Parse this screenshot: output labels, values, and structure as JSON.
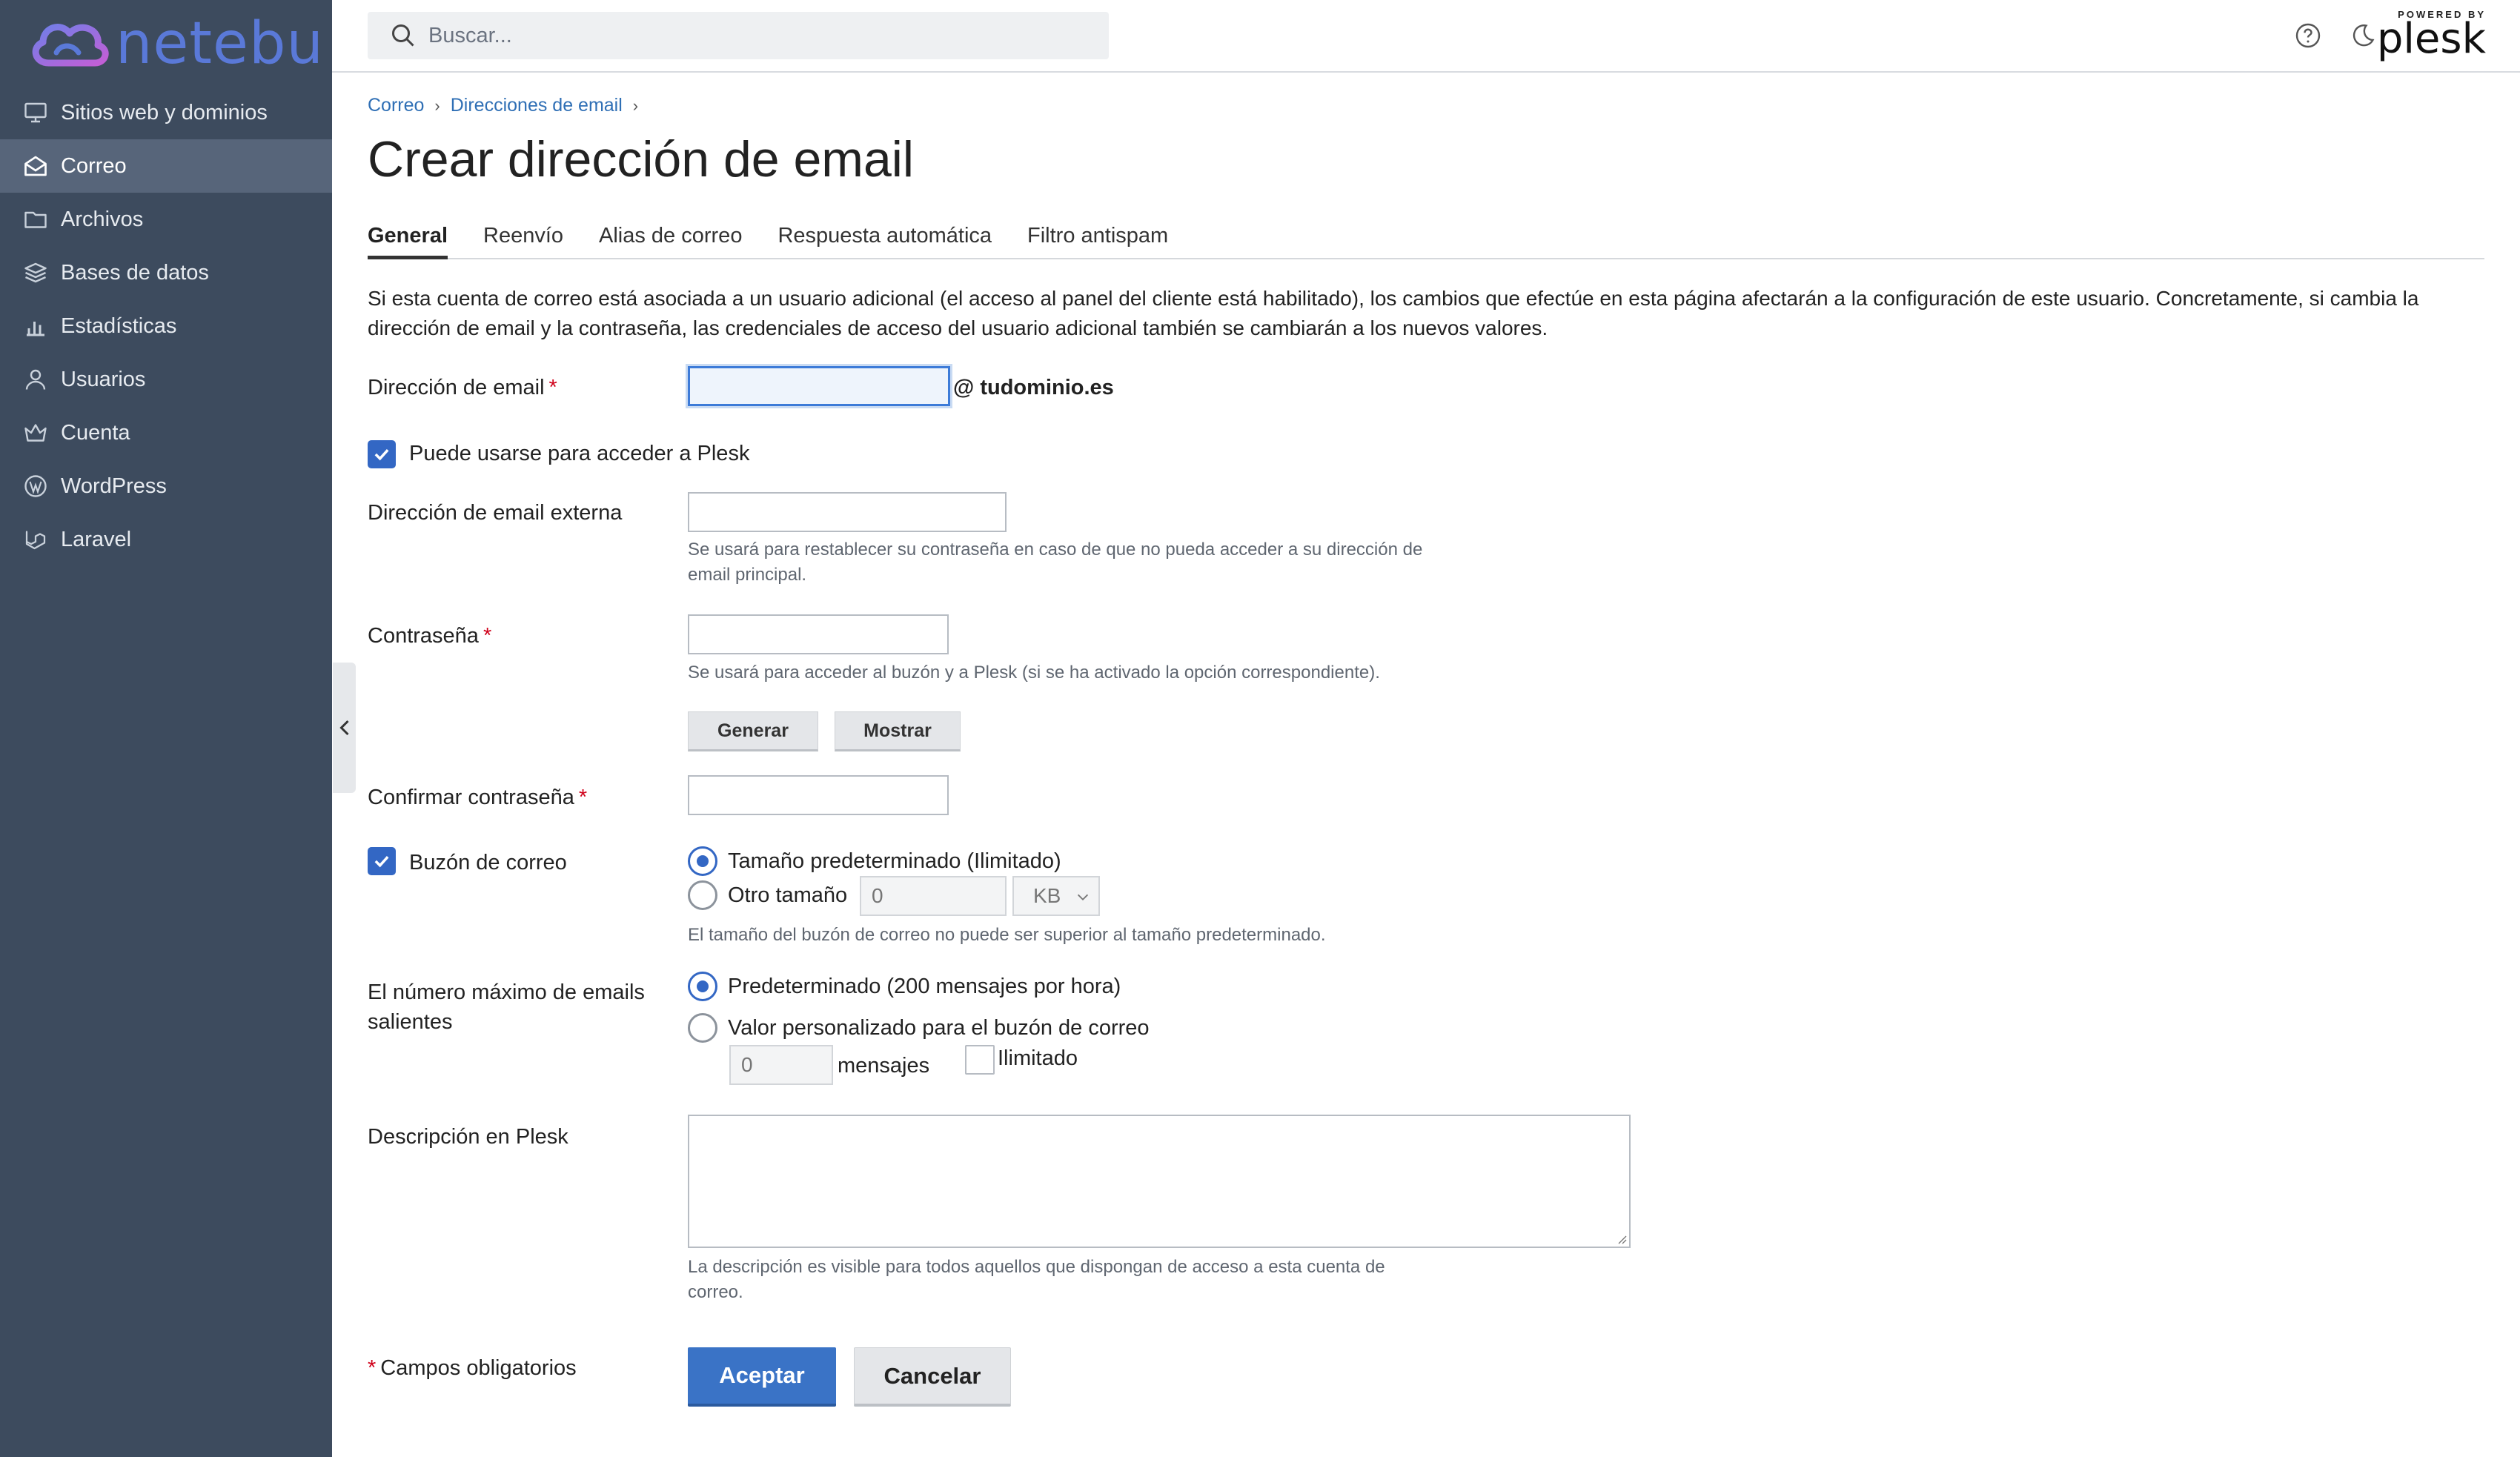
{
  "brand": {
    "name": "netebu",
    "colors": {
      "sidebar": "#3d4b5e",
      "active_item": "#57657a",
      "accent": "#3367c4",
      "link": "#2f6fb5",
      "required": "#d0021b"
    }
  },
  "search": {
    "placeholder": "Buscar..."
  },
  "header": {
    "powered_by": "POWERED BY",
    "plesk": "plesk"
  },
  "sidebar": {
    "items": [
      {
        "label": "Sitios web y dominios",
        "icon": "monitor-icon"
      },
      {
        "label": "Correo",
        "icon": "mail-icon",
        "active": true
      },
      {
        "label": "Archivos",
        "icon": "folder-icon"
      },
      {
        "label": "Bases de datos",
        "icon": "database-icon"
      },
      {
        "label": "Estadísticas",
        "icon": "bar-chart-icon"
      },
      {
        "label": "Usuarios",
        "icon": "user-icon"
      },
      {
        "label": "Cuenta",
        "icon": "crown-icon"
      },
      {
        "label": "WordPress",
        "icon": "wordpress-icon"
      },
      {
        "label": "Laravel",
        "icon": "laravel-icon"
      }
    ]
  },
  "breadcrumb": {
    "items": [
      "Correo",
      "Direcciones de email"
    ]
  },
  "page": {
    "title": "Crear dirección de email"
  },
  "tabs": [
    "General",
    "Reenvío",
    "Alias de correo",
    "Respuesta automática",
    "Filtro antispam"
  ],
  "intro": "Si esta cuenta de correo está asociada a un usuario adicional (el acceso al panel del cliente está habilitado), los cambios que efectúe en esta página afectarán a la configuración de este usuario. Concretamente, si cambia la dirección de email y la contraseña, las credenciales de acceso del usuario adicional también se cambiarán a los nuevos valores.",
  "form": {
    "email_label": "Dirección de email",
    "email_value": "",
    "domain_suffix": "@ tudominio.es",
    "plesk_access_label": "Puede usarse para acceder a Plesk",
    "plesk_access_checked": true,
    "external_email_label": "Dirección de email externa",
    "external_email_value": "",
    "external_email_hint": "Se usará para restablecer su contraseña en caso de que no pueda acceder a su dirección de email principal.",
    "password_label": "Contraseña",
    "password_hint": "Se usará para acceder al buzón y a Plesk (si se ha activado la opción correspondiente).",
    "generate_button": "Generar",
    "show_button": "Mostrar",
    "confirm_password_label": "Confirmar contraseña",
    "mailbox_label": "Buzón de correo",
    "mailbox_checked": true,
    "mailbox_default_option": "Tamaño predeterminado (Ilimitado)",
    "mailbox_other_option": "Otro tamaño",
    "mailbox_size_placeholder": "0",
    "mailbox_unit": "KB",
    "mailbox_hint": "El tamaño del buzón de correo no puede ser superior al tamaño predeterminado.",
    "outgoing_label": "El número máximo de emails salientes",
    "outgoing_default_option": "Predeterminado (200 mensajes por hora)",
    "outgoing_custom_option": "Valor personalizado para el buzón de correo",
    "outgoing_value_placeholder": "0",
    "outgoing_unit": "mensajes",
    "outgoing_unlimited_label": "Ilimitado",
    "description_label": "Descripción en Plesk",
    "description_value": "",
    "description_hint": "La descripción es visible para todos aquellos que dispongan de acceso a esta cuenta de correo.",
    "required_note": "Campos obligatorios",
    "required_mark": "*",
    "accept_button": "Aceptar",
    "cancel_button": "Cancelar"
  }
}
